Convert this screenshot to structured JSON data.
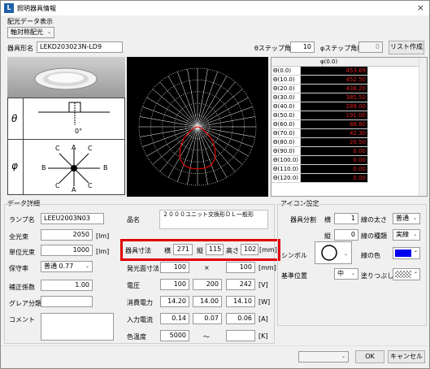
{
  "window": {
    "title": "照明器具情報",
    "close": "×"
  },
  "distribution": {
    "group_label": "配光データ表示",
    "mode": "軸対称配光",
    "name_label": "器具形名",
    "name_value": "LEKD203023N-LD9",
    "theta_step_label": "θステップ角度",
    "theta_step": "10",
    "phi_step_label": "φステップ角度",
    "phi_step": "0",
    "list_button": "リスト作成"
  },
  "icons": {
    "theta": "θ",
    "phi": "φ",
    "zero_deg": "0°",
    "letters": [
      "C",
      "A",
      "C",
      "B",
      "B",
      "C",
      "A",
      "C"
    ]
  },
  "table": {
    "header": "φ(0.0)",
    "rows": [
      {
        "angle": "Θ(0.0)",
        "value": "453.69"
      },
      {
        "angle": "Θ(10.0)",
        "value": "452.50"
      },
      {
        "angle": "Θ(20.0)",
        "value": "438.20"
      },
      {
        "angle": "Θ(30.0)",
        "value": "385.50"
      },
      {
        "angle": "Θ(40.0)",
        "value": "289.00"
      },
      {
        "angle": "Θ(50.0)",
        "value": "191.00"
      },
      {
        "angle": "Θ(60.0)",
        "value": "88.80"
      },
      {
        "angle": "Θ(70.0)",
        "value": "42.30"
      },
      {
        "angle": "Θ(80.0)",
        "value": "20.50"
      },
      {
        "angle": "Θ(90.0)",
        "value": "0.00"
      },
      {
        "angle": "Θ(100.0)",
        "value": "0.00"
      },
      {
        "angle": "Θ(110.0)",
        "value": "0.00"
      },
      {
        "angle": "Θ(120.0)",
        "value": "0.00"
      }
    ]
  },
  "details": {
    "group_label": "データ詳細",
    "lamp_label": "ランプ名",
    "lamp_value": "LEEU2003N03",
    "flux_label": "全光束",
    "flux_value": "2050",
    "flux_unit": "[lm]",
    "unit_flux_label": "単位光束",
    "unit_flux_value": "1000",
    "unit_flux_unit": "[lm]",
    "maint_label": "保守率",
    "maint_value": "普通 0.77",
    "corr_label": "補正係数",
    "corr_value": "1.00",
    "glare_label": "グレア分類",
    "comment_label": "コメント",
    "product_label": "品名",
    "product_value": "２０００ユニット交換形ＤＬ一般形",
    "dim_label": "器具寸法",
    "w_label": "横",
    "w_value": "271",
    "l_label": "縦",
    "l_value": "115",
    "h_label": "高さ",
    "h_value": "102",
    "dim_unit": "[mm]",
    "emit_label": "発光面寸法",
    "emit_w": "100",
    "emit_x": "×",
    "emit_l": "100",
    "emit_unit": "[mm]",
    "volt_label": "電圧",
    "volt": [
      "100",
      "200",
      "242"
    ],
    "volt_unit": "[V]",
    "power_label": "消費電力",
    "power": [
      "14.20",
      "14.00",
      "14.10"
    ],
    "power_unit": "[W]",
    "current_label": "入力電流",
    "current": [
      "0.14",
      "0.07",
      "0.06"
    ],
    "current_unit": "[A]",
    "cct_label": "色温度",
    "cct_min": "5000",
    "cct_tilde": "〜",
    "cct_unit": "[K]"
  },
  "icon_settings": {
    "group_label": "アイコン設定",
    "split_label": "器具分割",
    "h_label": "横",
    "h_value": "1",
    "v_label": "縦",
    "v_value": "0",
    "line_w_label": "線の太さ",
    "line_w_value": "普通",
    "line_t_label": "線の種類",
    "line_t_value": "実線",
    "symbol_label": "シンボル",
    "line_c_label": "線の色",
    "base_label": "基準位置",
    "base_value": "中",
    "fill_label": "塗りつぶし"
  },
  "footer": {
    "ok": "OK",
    "cancel": "キャンセル"
  },
  "colors": {
    "value_bg": "#000000",
    "value_fg": "#e02020",
    "highlight": "#e00000",
    "line_color": "#0000ee"
  }
}
